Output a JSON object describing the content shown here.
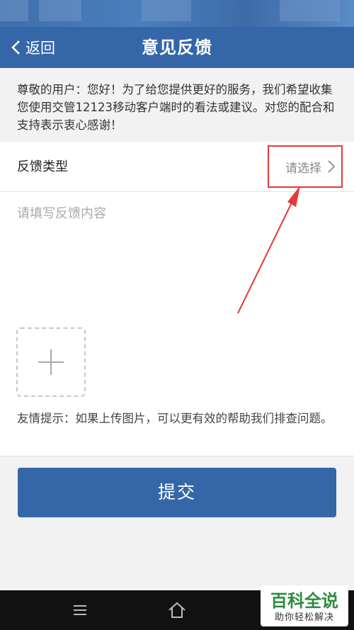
{
  "nav": {
    "back_label": "返回",
    "title": "意见反馈"
  },
  "notice": {
    "text": "尊敬的用户：您好！为了给您提供更好的服务，我们希望收集您使用交管12123移动客户端时的看法或建议。对您的配合和支持表示衷心感谢！"
  },
  "feedback_type": {
    "label": "反馈类型",
    "value": "请选择"
  },
  "content": {
    "placeholder": "请填写反馈内容"
  },
  "tip": {
    "text": "友情提示：如果上传图片，可以更有效的帮助我们排查问题。"
  },
  "submit_label": "提交",
  "watermark": {
    "title": "百科全说",
    "subtitle": "助你轻松解决"
  },
  "colors": {
    "primary": "#3567a8",
    "highlight": "#e53935"
  }
}
